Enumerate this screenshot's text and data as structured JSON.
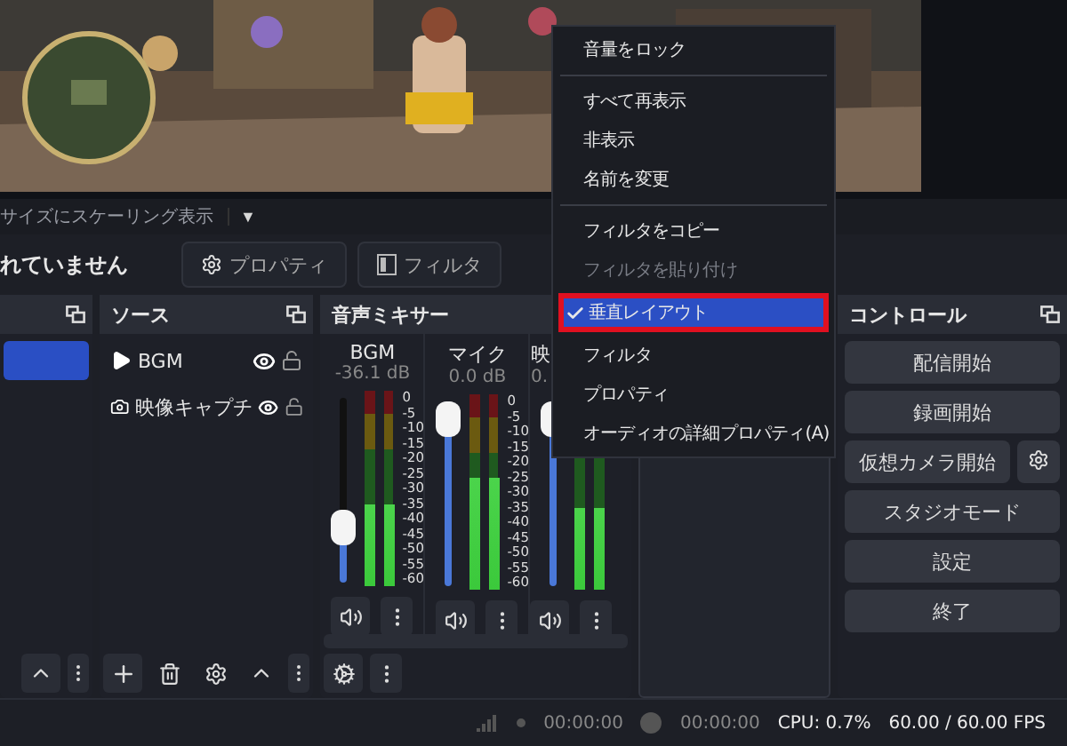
{
  "scale_bar": {
    "label": "サイズにスケーリング表示",
    "dropdown": "▼"
  },
  "toolbar": {
    "status": "れていません",
    "buttons": [
      {
        "label": "プロパティ",
        "kind": "gear"
      },
      {
        "label": "フィルタ",
        "kind": "filter"
      }
    ]
  },
  "scenes": {
    "items": [
      {
        "selected": true
      }
    ]
  },
  "sources": {
    "title": "ソース",
    "items": [
      {
        "name": "BGM",
        "kind": "audio",
        "visible": true,
        "locked": false
      },
      {
        "name": "映像キャプチ",
        "kind": "camera",
        "visible": true,
        "locked": false
      }
    ]
  },
  "mixer": {
    "title": "音声ミキサー",
    "channels": [
      {
        "name": "BGM",
        "reading": "-36.1 dB",
        "level": 0.3,
        "meters": [
          {
            "level": 0.42
          },
          {
            "level": 0.42
          }
        ],
        "scale": [
          "0",
          "-5",
          "-10",
          "-15",
          "-20",
          "-25",
          "-30",
          "-35",
          "-40",
          "-45",
          "-50",
          "-55",
          "-60"
        ]
      },
      {
        "name": "マイク",
        "reading": "0.0 dB",
        "level": 1,
        "meters": [
          {
            "level": 0.57
          },
          {
            "level": 0.57
          }
        ],
        "scale": [
          "0",
          "-5",
          "-10",
          "-15",
          "-20",
          "-25",
          "-30",
          "-35",
          "-40",
          "-45",
          "-50",
          "-55",
          "-60"
        ]
      },
      {
        "name": "映",
        "reading": "0.",
        "level": 1,
        "meters": [
          {
            "level": 0.42
          },
          {
            "level": 0.42
          }
        ]
      }
    ]
  },
  "controls": {
    "title": "コントロール",
    "buttons": [
      {
        "label": "配信開始",
        "kind": "plain"
      },
      {
        "label": "録画開始",
        "kind": "plain"
      },
      {
        "label": "仮想カメラ開始",
        "kind": "with_settings"
      },
      {
        "label": "スタジオモード",
        "kind": "plain"
      },
      {
        "label": "設定",
        "kind": "plain"
      },
      {
        "label": "終了",
        "kind": "plain"
      }
    ]
  },
  "context_menu": {
    "items": [
      {
        "kind": "item",
        "label": "音量をロック",
        "checked": false,
        "selected": false,
        "disabled": false
      },
      {
        "kind": "separator"
      },
      {
        "kind": "item",
        "label": "すべて再表示",
        "checked": false,
        "selected": false,
        "disabled": false
      },
      {
        "kind": "item",
        "label": "非表示",
        "checked": false,
        "selected": false,
        "disabled": false
      },
      {
        "kind": "item",
        "label": "名前を変更",
        "checked": false,
        "selected": false,
        "disabled": false
      },
      {
        "kind": "separator"
      },
      {
        "kind": "item",
        "label": "フィルタをコピー",
        "checked": false,
        "selected": false,
        "disabled": false
      },
      {
        "kind": "item",
        "label": "フィルタを貼り付け",
        "checked": false,
        "selected": false,
        "disabled": true
      },
      {
        "kind": "item",
        "label": "垂直レイアウト",
        "checked": true,
        "selected": true,
        "disabled": false
      },
      {
        "kind": "item",
        "label": "フィルタ",
        "checked": false,
        "selected": false,
        "disabled": false
      },
      {
        "kind": "item",
        "label": "プロパティ",
        "checked": false,
        "selected": false,
        "disabled": false
      },
      {
        "kind": "item",
        "label": "オーディオの詳細プロパティ(A)",
        "checked": false,
        "selected": false,
        "disabled": false
      }
    ]
  },
  "status_bar": {
    "stream_time": "00:00:00",
    "record_time": "00:00:00",
    "cpu": "CPU: 0.7%",
    "fps": "60.00 / 60.00 FPS"
  }
}
